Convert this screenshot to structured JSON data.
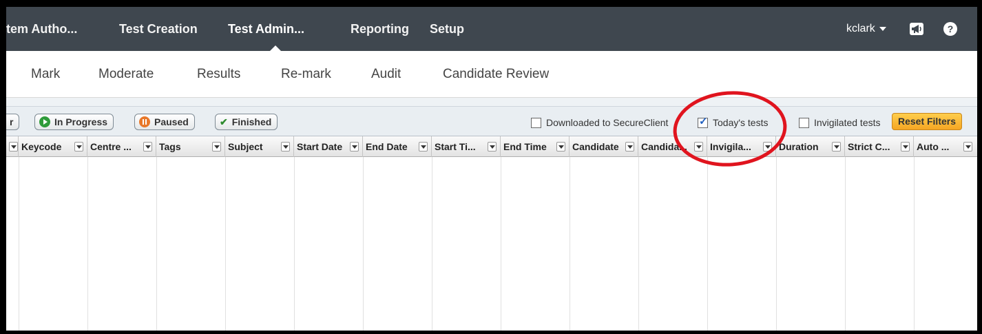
{
  "topnav": {
    "items": [
      {
        "label": "tem Autho..."
      },
      {
        "label": "Test Creation"
      },
      {
        "label": "Test Admin..."
      },
      {
        "label": "Reporting"
      },
      {
        "label": "Setup"
      }
    ],
    "user": "kclark",
    "help": "?"
  },
  "subnav": {
    "tabs": [
      {
        "label": "Mark"
      },
      {
        "label": "Moderate"
      },
      {
        "label": "Results"
      },
      {
        "label": "Re-mark"
      },
      {
        "label": "Audit"
      },
      {
        "label": "Candidate Review"
      }
    ]
  },
  "filters": {
    "status_buttons": [
      {
        "label": "r"
      },
      {
        "label": "In Progress"
      },
      {
        "label": "Paused"
      },
      {
        "label": "Finished"
      }
    ],
    "checkboxes": [
      {
        "label": "Downloaded to SecureClient",
        "checked": false
      },
      {
        "label": "Today's tests",
        "checked": true
      },
      {
        "label": "Invigilated tests",
        "checked": false
      }
    ],
    "reset_label": "Reset Filters"
  },
  "table": {
    "columns": [
      {
        "label": ""
      },
      {
        "label": "Keycode"
      },
      {
        "label": "Centre ..."
      },
      {
        "label": "Tags"
      },
      {
        "label": "Subject"
      },
      {
        "label": "Start Date"
      },
      {
        "label": "End Date"
      },
      {
        "label": "Start Ti..."
      },
      {
        "label": "End Time"
      },
      {
        "label": "Candidate"
      },
      {
        "label": "Candida..."
      },
      {
        "label": "Invigila..."
      },
      {
        "label": "Duration"
      },
      {
        "label": "Strict C..."
      },
      {
        "label": "Auto ..."
      }
    ],
    "rows": []
  },
  "colors": {
    "topnav_bg": "#3f474f",
    "reset_button": "#f5a623",
    "annotation_circle": "#e0141e",
    "in_progress_icon": "#2e9b3a",
    "paused_icon": "#e8782a"
  }
}
